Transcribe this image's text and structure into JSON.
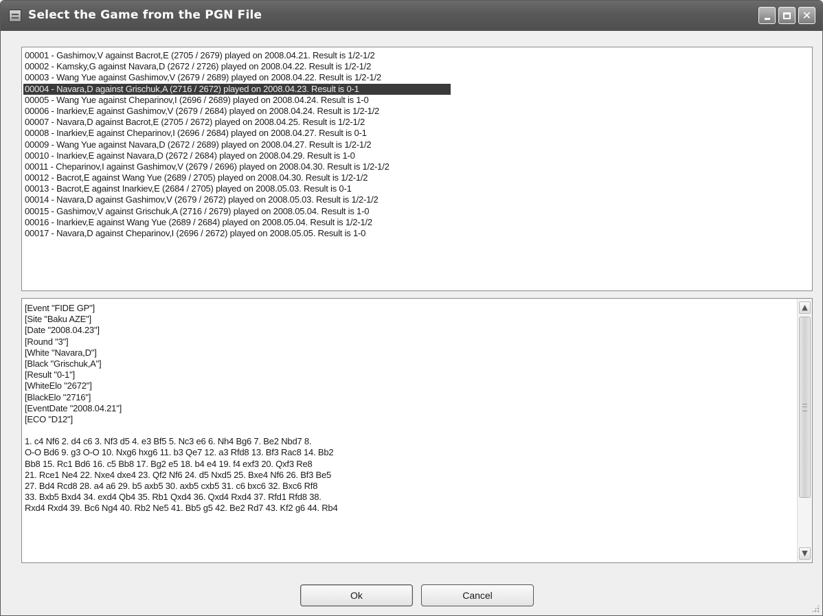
{
  "window": {
    "title": "Select the Game from the PGN File"
  },
  "game_list": {
    "selected_index": 3,
    "items": [
      "00001 - Gashimov,V against Bacrot,E (2705 / 2679) played on 2008.04.21. Result is 1/2-1/2",
      "00002 - Kamsky,G against Navara,D (2672 / 2726) played on 2008.04.22. Result is 1/2-1/2",
      "00003 - Wang Yue against Gashimov,V (2679 / 2689) played on 2008.04.22. Result is 1/2-1/2",
      "00004 - Navara,D against Grischuk,A (2716 / 2672) played on 2008.04.23. Result is 0-1",
      "00005 - Wang Yue against Cheparinov,I (2696 / 2689) played on 2008.04.24. Result is 1-0",
      "00006 - Inarkiev,E against Gashimov,V (2679 / 2684) played on 2008.04.24. Result is 1/2-1/2",
      "00007 - Navara,D against Bacrot,E (2705 / 2672) played on 2008.04.25. Result is 1/2-1/2",
      "00008 - Inarkiev,E against Cheparinov,I (2696 / 2684) played on 2008.04.27. Result is 0-1",
      "00009 - Wang Yue against Navara,D (2672 / 2689) played on 2008.04.27. Result is 1/2-1/2",
      "00010 - Inarkiev,E against Navara,D (2672 / 2684) played on 2008.04.29. Result is 1-0",
      "00011 - Cheparinov,I against Gashimov,V (2679 / 2696) played on 2008.04.30. Result is 1/2-1/2",
      "00012 - Bacrot,E against Wang Yue (2689 / 2705) played on 2008.04.30. Result is 1/2-1/2",
      "00013 - Bacrot,E against Inarkiev,E (2684 / 2705) played on 2008.05.03. Result is 0-1",
      "00014 - Navara,D against Gashimov,V (2679 / 2672) played on 2008.05.03. Result is 1/2-1/2",
      "00015 - Gashimov,V against Grischuk,A (2716 / 2679) played on 2008.05.04. Result is 1-0",
      "00016 - Inarkiev,E against Wang Yue (2689 / 2684) played on 2008.05.04. Result is 1/2-1/2",
      "00017 - Navara,D against Cheparinov,I (2696 / 2672) played on 2008.05.05. Result is 1-0"
    ]
  },
  "pgn": {
    "headers": [
      "[Event \"FIDE GP\"]",
      "[Site \"Baku AZE\"]",
      "[Date \"2008.04.23\"]",
      "[Round \"3\"]",
      "[White \"Navara,D\"]",
      "[Black \"Grischuk,A\"]",
      "[Result \"0-1\"]",
      "[WhiteElo \"2672\"]",
      "[BlackElo \"2716\"]",
      "[EventDate \"2008.04.21\"]",
      "[ECO \"D12\"]"
    ],
    "moves": [
      "1. c4 Nf6 2. d4 c6 3. Nf3 d5 4. e3 Bf5 5. Nc3 e6 6. Nh4 Bg6 7. Be2 Nbd7 8.",
      "O-O Bd6 9. g3 O-O 10. Nxg6 hxg6 11. b3 Qe7 12. a3 Rfd8 13. Bf3 Rac8 14. Bb2",
      "Bb8 15. Rc1 Bd6 16. c5 Bb8 17. Bg2 e5 18. b4 e4 19. f4 exf3 20. Qxf3 Re8",
      "21. Rce1 Ne4 22. Nxe4 dxe4 23. Qf2 Nf6 24. d5 Nxd5 25. Bxe4 Nf6 26. Bf3 Be5",
      "27. Bd4 Rcd8 28. a4 a6 29. b5 axb5 30. axb5 cxb5 31. c6 bxc6 32. Bxc6 Rf8",
      "33. Bxb5 Bxd4 34. exd4 Qb4 35. Rb1 Qxd4 36. Qxd4 Rxd4 37. Rfd1 Rfd8 38.",
      "Rxd4 Rxd4 39. Bc6 Ng4 40. Rb2 Ne5 41. Bb5 g5 42. Be2 Rd7 43. Kf2 g6 44. Rb4"
    ]
  },
  "buttons": {
    "ok": "Ok",
    "cancel": "Cancel"
  },
  "icons": {
    "title": "app-window-icon",
    "minimize": "minimize-icon",
    "maximize": "maximize-icon",
    "close": "close-icon",
    "scroll_up": "chevron-up-icon",
    "scroll_down": "chevron-down-icon"
  },
  "colors": {
    "titlebar": "#5a5a5a",
    "selection": "#3a3a3a",
    "window_bg": "#efefef"
  }
}
